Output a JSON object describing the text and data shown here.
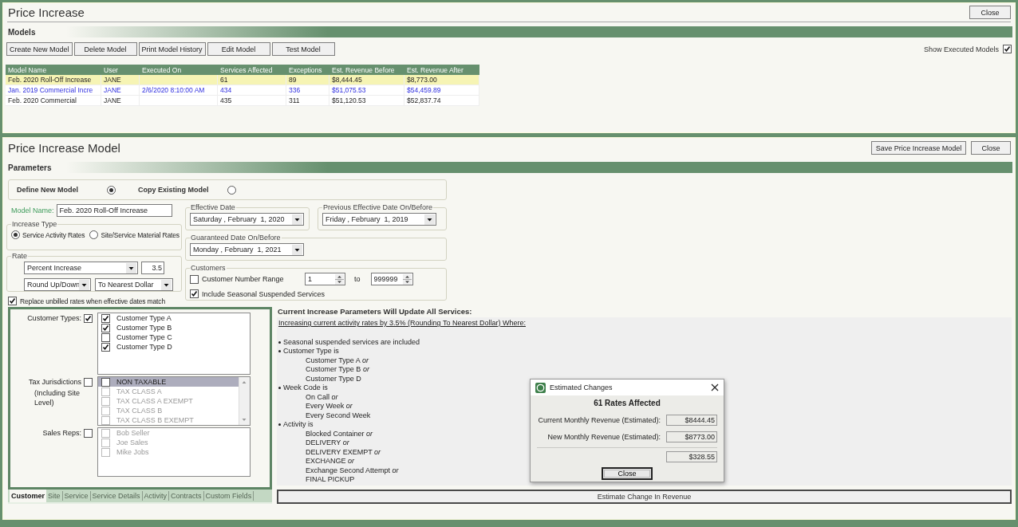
{
  "window": {
    "title": "Price Increase",
    "close_button": "Close"
  },
  "models": {
    "section_title": "Models",
    "buttons": [
      "Create New Model",
      "Delete Model",
      "Print Model History",
      "Edit Model",
      "Test Model"
    ],
    "show_executed": {
      "label": "Show Executed Models",
      "checked": true
    },
    "table": {
      "columns": [
        "Model Name",
        "User",
        "Executed On",
        "Services Affected",
        "Exceptions",
        "Est. Revenue Before",
        "Est. Revenue After"
      ],
      "rows": [
        {
          "cells": [
            "Feb. 2020 Roll-Off Increase",
            "JANE",
            "",
            "61",
            "89",
            "$8,444.45",
            "$8,773.00"
          ],
          "selected": true,
          "executed": false
        },
        {
          "cells": [
            "Jan. 2019 Commercial Incre",
            "JANE",
            "2/6/2020 8:10:00 AM",
            "434",
            "336",
            "$51,075.53",
            "$54,459.89"
          ],
          "selected": false,
          "executed": true
        },
        {
          "cells": [
            "Feb. 2020 Commercial",
            "JANE",
            "",
            "435",
            "311",
            "$51,120.53",
            "$52,837.74"
          ],
          "selected": false,
          "executed": false
        }
      ]
    }
  },
  "editor": {
    "title": "Price Increase Model",
    "buttons": [
      "Save Price Increase Model",
      "Close"
    ],
    "section_title": "Parameters",
    "mode_options": [
      {
        "label": "Define New Model",
        "selected": true
      },
      {
        "label": "Copy Existing Model",
        "selected": false
      }
    ],
    "model_name": {
      "label": "Model Name:",
      "value": "Feb. 2020 Roll-Off Increase"
    },
    "increase_type": {
      "title": "Increase Type",
      "options": [
        {
          "label": "Service Activity Rates",
          "selected": true
        },
        {
          "label": "Site/Service Material Rates",
          "selected": false
        }
      ]
    },
    "rate": {
      "title": "Rate",
      "method": "Percent Increase",
      "amount": "3.5",
      "rounding": "Round Up/Down",
      "round_to": "To Nearest Dollar"
    },
    "replace_unbilled": {
      "label": "Replace unbilled rates when effective dates match",
      "checked": true
    },
    "effective_date": {
      "title": "Effective Date",
      "value": "Saturday , February  1, 2020"
    },
    "previous_date": {
      "title": "Previous Effective Date On/Before",
      "value": "Friday , February  1, 2019"
    },
    "guaranteed_date": {
      "title": "Guaranteed Date On/Before",
      "value": "Monday , February  1, 2021"
    },
    "customers": {
      "title": "Customers",
      "range": {
        "label": "Customer Number Range",
        "checked": false,
        "from": "1",
        "to_label": "to",
        "to": "999999"
      },
      "seasonal": {
        "label": "Include Seasonal Suspended Services",
        "checked": true
      }
    },
    "filters": [
      {
        "label": "Customer Types:",
        "checked": true,
        "scrollable": false,
        "items": [
          {
            "label": "Customer Type A",
            "checked": true,
            "selected": false,
            "disabled": false
          },
          {
            "label": "Customer Type B",
            "checked": true,
            "selected": false,
            "disabled": false
          },
          {
            "label": "Customer Type C",
            "checked": false,
            "selected": false,
            "disabled": false
          },
          {
            "label": "Customer Type D",
            "checked": true,
            "selected": false,
            "disabled": false
          }
        ]
      },
      {
        "label": "Tax Jurisdictions",
        "note": "(Including Site Level)",
        "checked": false,
        "scrollable": true,
        "items": [
          {
            "label": "NON TAXABLE",
            "checked": false,
            "selected": true,
            "disabled": false
          },
          {
            "label": "TAX CLASS A",
            "checked": false,
            "selected": false,
            "disabled": true
          },
          {
            "label": "TAX CLASS A  EXEMPT",
            "checked": false,
            "selected": false,
            "disabled": true
          },
          {
            "label": "TAX CLASS B",
            "checked": false,
            "selected": false,
            "disabled": true
          },
          {
            "label": "TAX CLASS B EXEMPT",
            "checked": false,
            "selected": false,
            "disabled": true
          }
        ]
      },
      {
        "label": "Sales Reps:",
        "checked": false,
        "scrollable": false,
        "items": [
          {
            "label": "Bob Seller",
            "checked": false,
            "selected": false,
            "disabled": true
          },
          {
            "label": "Joe Sales",
            "checked": false,
            "selected": false,
            "disabled": true
          },
          {
            "label": "Mike Jobs",
            "checked": false,
            "selected": false,
            "disabled": true
          }
        ]
      }
    ],
    "tabs": [
      {
        "label": "Customer",
        "selected": true
      },
      {
        "label": "Site",
        "selected": false
      },
      {
        "label": "Service",
        "selected": false
      },
      {
        "label": "Service Details",
        "selected": false
      },
      {
        "label": "Activity",
        "selected": false
      },
      {
        "label": "Contracts",
        "selected": false
      },
      {
        "label": "Custom Fields",
        "selected": false
      }
    ],
    "summary": {
      "title": "Current Increase Parameters Will Update All Services:",
      "subtitle": "Increasing current activity rates by 3.5%  (Rounding To Nearest Dollar)  Where:",
      "criteria": [
        {
          "text": "Seasonal suspended services are included"
        },
        {
          "text": "Customer Type is",
          "values": [
            "Customer Type A *or*",
            "Customer Type B *or*",
            "Customer Type D"
          ]
        },
        {
          "text": "Week Code is",
          "values": [
            "On Call *or*",
            "Every Week *or*",
            "Every Second Week"
          ]
        },
        {
          "text": "Activity is",
          "values": [
            "Blocked Container *or*",
            "DELIVERY *or*",
            "DELIVERY EXEMPT *or*",
            "EXCHANGE *or*",
            "Exchange Second Attempt *or*",
            "FINAL PICKUP"
          ]
        }
      ]
    },
    "estimate_button": "Estimate Change In Revenue"
  },
  "dialog": {
    "title": "Estimated Changes",
    "heading": "61 Rates Affected",
    "rows": [
      {
        "label": "Current Monthly Revenue (Estimated):",
        "value": "$8444.45"
      },
      {
        "label": "New Monthly Revenue (Estimated):",
        "value": "$8773.00"
      }
    ],
    "difference": "$328.55",
    "close_button": "Close"
  }
}
